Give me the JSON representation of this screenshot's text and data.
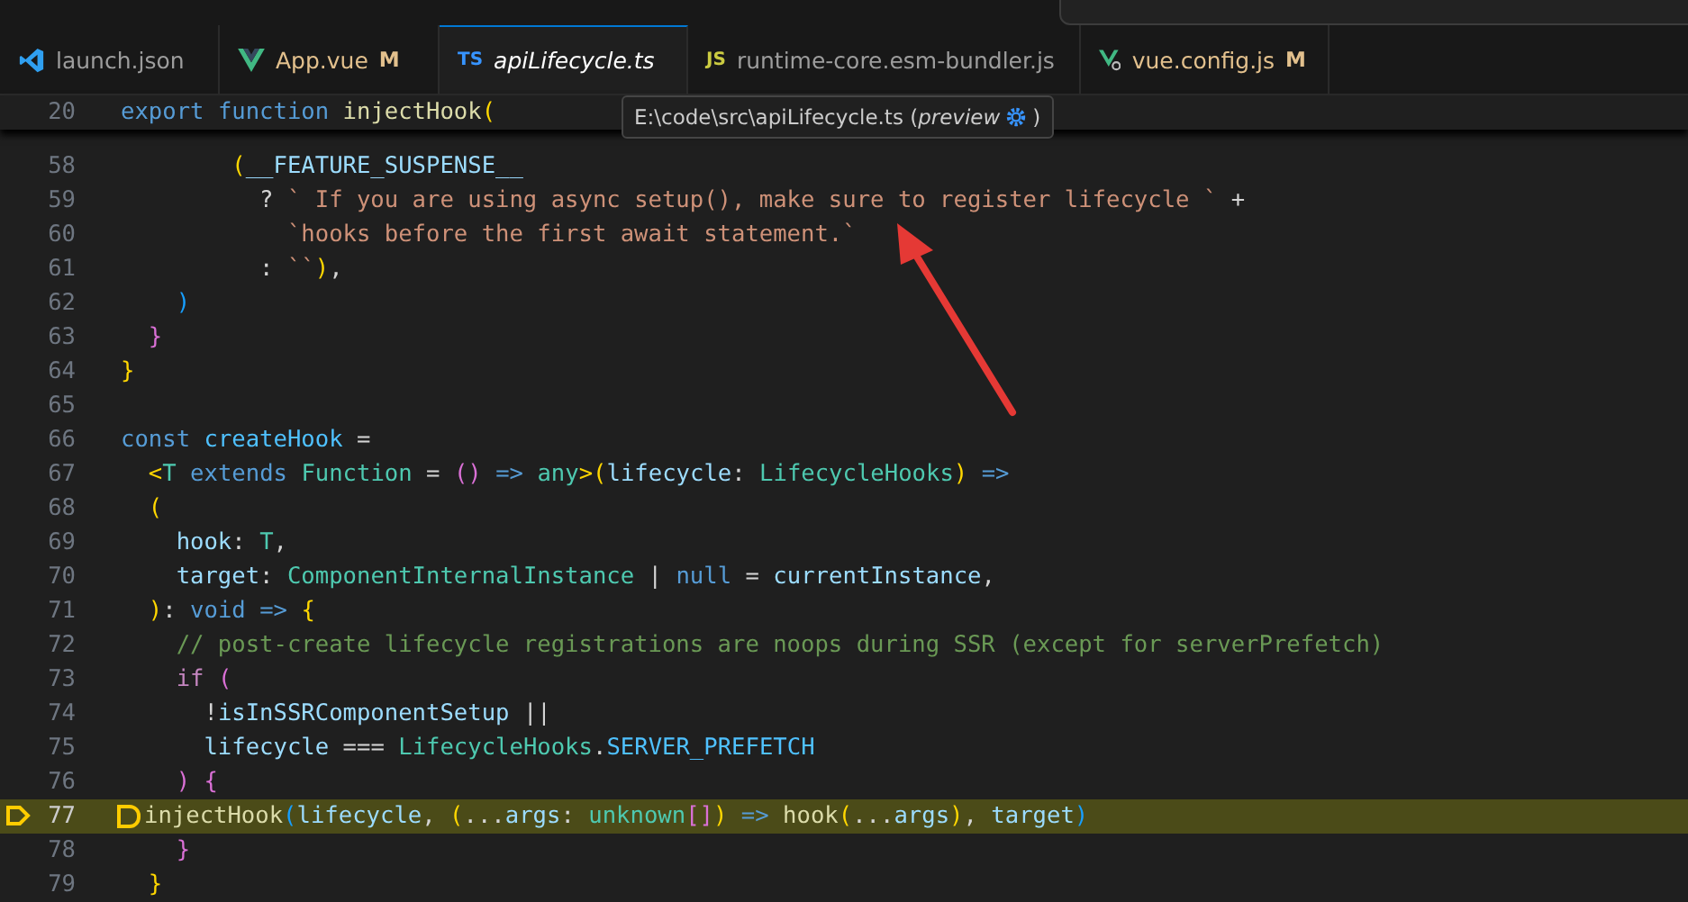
{
  "tabs": [
    {
      "label": "launch.json",
      "kind": "vscode",
      "selected": false,
      "italic": false
    },
    {
      "label": "App.vue",
      "kind": "vue",
      "badge": "M",
      "selected": false,
      "italic": false
    },
    {
      "label": "apiLifecycle.ts",
      "kind": "text",
      "icon_label": "TS",
      "selected": true,
      "italic": true
    },
    {
      "label": "runtime-core.esm-bundler.js",
      "kind": "text",
      "icon_label": "JS",
      "selected": false,
      "italic": false
    },
    {
      "label": "vue.config.js",
      "kind": "vueconfig",
      "badge": "M",
      "selected": false,
      "italic": false
    }
  ],
  "sticky_line": {
    "number": "20",
    "tokens": [
      {
        "t": "export ",
        "kind": "keyword"
      },
      {
        "t": "function ",
        "kind": "keyword"
      },
      {
        "t": "injectHook",
        "kind": "function"
      },
      {
        "t": "(",
        "kind": "b1"
      }
    ]
  },
  "tooltip": {
    "text": "E:\\code\\src\\apiLifecycle.ts (*preview*",
    "closing": ")"
  },
  "lines": [
    {
      "number": "58",
      "current": false,
      "tokens": [
        {
          "t": "        (",
          "kind": "b1"
        },
        {
          "t": "__FEATURE_SUSPENSE__",
          "kind": "variable"
        }
      ]
    },
    {
      "number": "59",
      "current": false,
      "tokens": [
        {
          "t": "          ? ",
          "kind": "punct"
        },
        {
          "t": "` If you are using async setup(), make sure to register lifecycle ` ",
          "kind": "string"
        },
        {
          "t": "+",
          "kind": "punct"
        }
      ]
    },
    {
      "number": "60",
      "current": false,
      "tokens": [
        {
          "t": "            `hooks before the first await statement.`",
          "kind": "string"
        }
      ]
    },
    {
      "number": "61",
      "current": false,
      "tokens": [
        {
          "t": "          : ",
          "kind": "punct"
        },
        {
          "t": "``",
          "kind": "string"
        },
        {
          "t": ")",
          "kind": "b1"
        },
        {
          "t": ",",
          "kind": "punct"
        }
      ]
    },
    {
      "number": "62",
      "current": false,
      "tokens": [
        {
          "t": "    )",
          "kind": "b3"
        }
      ]
    },
    {
      "number": "63",
      "current": false,
      "tokens": [
        {
          "t": "  }",
          "kind": "b2"
        }
      ]
    },
    {
      "number": "64",
      "current": false,
      "tokens": [
        {
          "t": "}",
          "kind": "b1"
        }
      ]
    },
    {
      "number": "65",
      "current": false
    },
    {
      "number": "66",
      "current": false,
      "tokens": [
        {
          "t": "const ",
          "kind": "keyword"
        },
        {
          "t": "createHook",
          "kind": "constant"
        },
        {
          "t": " =",
          "kind": "punct"
        }
      ]
    },
    {
      "number": "67",
      "current": false,
      "tokens": [
        {
          "t": "  <",
          "kind": "b1"
        },
        {
          "t": "T ",
          "kind": "type"
        },
        {
          "t": "extends ",
          "kind": "keyword"
        },
        {
          "t": "Function",
          "kind": "type"
        },
        {
          "t": " = ",
          "kind": "punct"
        },
        {
          "t": "()",
          "kind": "b2"
        },
        {
          "t": " => ",
          "kind": "keyword"
        },
        {
          "t": "any",
          "kind": "type"
        },
        {
          "t": ">",
          "kind": "b1"
        },
        {
          "t": "(",
          "kind": "b1"
        },
        {
          "t": "lifecycle",
          "kind": "variable"
        },
        {
          "t": ": ",
          "kind": "punct"
        },
        {
          "t": "LifecycleHooks",
          "kind": "type"
        },
        {
          "t": ")",
          "kind": "b1"
        },
        {
          "t": " =>",
          "kind": "keyword"
        }
      ]
    },
    {
      "number": "68",
      "current": false,
      "tokens": [
        {
          "t": "  (",
          "kind": "b1"
        }
      ]
    },
    {
      "number": "69",
      "current": false,
      "tokens": [
        {
          "t": "    hook",
          "kind": "variable"
        },
        {
          "t": ": ",
          "kind": "punct"
        },
        {
          "t": "T",
          "kind": "type"
        },
        {
          "t": ",",
          "kind": "punct"
        }
      ]
    },
    {
      "number": "70",
      "current": false,
      "tokens": [
        {
          "t": "    target",
          "kind": "variable"
        },
        {
          "t": ": ",
          "kind": "punct"
        },
        {
          "t": "ComponentInternalInstance",
          "kind": "type"
        },
        {
          "t": " | ",
          "kind": "punct"
        },
        {
          "t": "null",
          "kind": "keyword"
        },
        {
          "t": " = ",
          "kind": "punct"
        },
        {
          "t": "currentInstance",
          "kind": "variable"
        },
        {
          "t": ",",
          "kind": "punct"
        }
      ]
    },
    {
      "number": "71",
      "current": false,
      "tokens": [
        {
          "t": "  )",
          "kind": "b1"
        },
        {
          "t": ": ",
          "kind": "punct"
        },
        {
          "t": "void",
          "kind": "keyword"
        },
        {
          "t": " => ",
          "kind": "keyword"
        },
        {
          "t": "{",
          "kind": "b1"
        }
      ]
    },
    {
      "number": "72",
      "current": false,
      "tokens": [
        {
          "t": "    // post-create lifecycle registrations are noops during SSR (except for serverPrefetch)",
          "kind": "comment"
        }
      ]
    },
    {
      "number": "73",
      "current": false,
      "tokens": [
        {
          "t": "    if ",
          "kind": "control"
        },
        {
          "t": "(",
          "kind": "b2"
        }
      ]
    },
    {
      "number": "74",
      "current": false,
      "tokens": [
        {
          "t": "      !",
          "kind": "punct"
        },
        {
          "t": "isInSSRComponentSetup",
          "kind": "variable"
        },
        {
          "t": " ||",
          "kind": "punct"
        }
      ]
    },
    {
      "number": "75",
      "current": false,
      "tokens": [
        {
          "t": "      lifecycle",
          "kind": "variable"
        },
        {
          "t": " === ",
          "kind": "punct"
        },
        {
          "t": "LifecycleHooks",
          "kind": "type"
        },
        {
          "t": ".",
          "kind": "punct"
        },
        {
          "t": "SERVER_PREFETCH",
          "kind": "constant"
        }
      ]
    },
    {
      "number": "76",
      "current": false,
      "tokens": [
        {
          "t": "    )",
          "kind": "b2"
        },
        {
          "t": " {",
          "kind": "b2"
        }
      ]
    },
    {
      "number": "77",
      "current": true,
      "tokens": [
        {
          "t": "injectHook",
          "kind": "function"
        },
        {
          "t": "(",
          "kind": "b3"
        },
        {
          "t": "lifecycle",
          "kind": "variable"
        },
        {
          "t": ", ",
          "kind": "punct"
        },
        {
          "t": "(",
          "kind": "b1"
        },
        {
          "t": "...",
          "kind": "punct"
        },
        {
          "t": "args",
          "kind": "variable"
        },
        {
          "t": ": ",
          "kind": "punct"
        },
        {
          "t": "unknown",
          "kind": "type"
        },
        {
          "t": "[]",
          "kind": "b2"
        },
        {
          "t": ")",
          "kind": "b1"
        },
        {
          "t": " => ",
          "kind": "keyword"
        },
        {
          "t": "hook",
          "kind": "function"
        },
        {
          "t": "(",
          "kind": "b1"
        },
        {
          "t": "...",
          "kind": "punct"
        },
        {
          "t": "args",
          "kind": "variable"
        },
        {
          "t": ")",
          "kind": "b1"
        },
        {
          "t": ", ",
          "kind": "punct"
        },
        {
          "t": "target",
          "kind": "variable"
        },
        {
          "t": ")",
          "kind": "b3"
        }
      ]
    },
    {
      "number": "78",
      "current": false,
      "tokens": [
        {
          "t": "    }",
          "kind": "b2"
        }
      ]
    },
    {
      "number": "79",
      "current": false,
      "tokens": [
        {
          "t": "  }",
          "kind": "b1"
        }
      ]
    }
  ]
}
